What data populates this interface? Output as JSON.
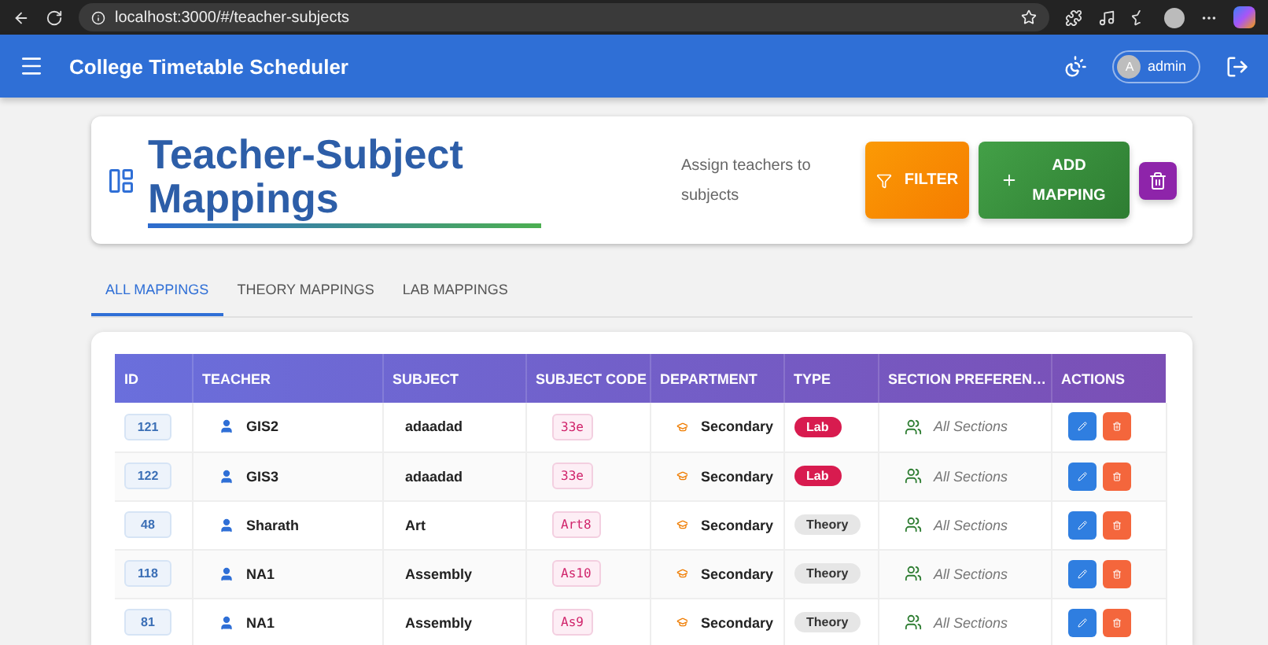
{
  "browser": {
    "url": "localhost:3000/#/teacher-subjects"
  },
  "app_bar": {
    "title": "College Timetable Scheduler",
    "user": {
      "initial": "A",
      "name": "admin"
    }
  },
  "header": {
    "title": "Teacher-Subject Mappings",
    "subtitle": "Assign teachers to subjects",
    "buttons": [
      {
        "kind": "filter",
        "label": "FILTER"
      },
      {
        "kind": "add",
        "label": "ADD MAPPING"
      },
      {
        "kind": "delete"
      }
    ]
  },
  "tabs": [
    {
      "label": "ALL MAPPINGS",
      "selected": true
    },
    {
      "label": "THEORY MAPPINGS",
      "selected": false
    },
    {
      "label": "LAB MAPPINGS",
      "selected": false
    }
  ],
  "table": {
    "columns": [
      "ID",
      "TEACHER",
      "SUBJECT",
      "SUBJECT CODE",
      "DEPARTMENT",
      "TYPE",
      "SECTION PREFEREN…",
      "ACTIONS"
    ],
    "rows": [
      {
        "id": "121",
        "teacher": "GIS2",
        "subject": "adaadad",
        "code": "33e",
        "department": "Secondary",
        "type": {
          "kind": "lab",
          "label": "Lab"
        },
        "sections": "All Sections"
      },
      {
        "id": "122",
        "teacher": "GIS3",
        "subject": "adaadad",
        "code": "33e",
        "department": "Secondary",
        "type": {
          "kind": "lab",
          "label": "Lab"
        },
        "sections": "All Sections"
      },
      {
        "id": "48",
        "teacher": "Sharath",
        "subject": "Art",
        "code": "Art8",
        "department": "Secondary",
        "type": {
          "kind": "theory",
          "label": "Theory"
        },
        "sections": "All Sections"
      },
      {
        "id": "118",
        "teacher": "NA1",
        "subject": "Assembly",
        "code": "As10",
        "department": "Secondary",
        "type": {
          "kind": "theory",
          "label": "Theory"
        },
        "sections": "All Sections"
      },
      {
        "id": "81",
        "teacher": "NA1",
        "subject": "Assembly",
        "code": "As9",
        "department": "Secondary",
        "type": {
          "kind": "theory",
          "label": "Theory"
        },
        "sections": "All Sections"
      }
    ]
  }
}
